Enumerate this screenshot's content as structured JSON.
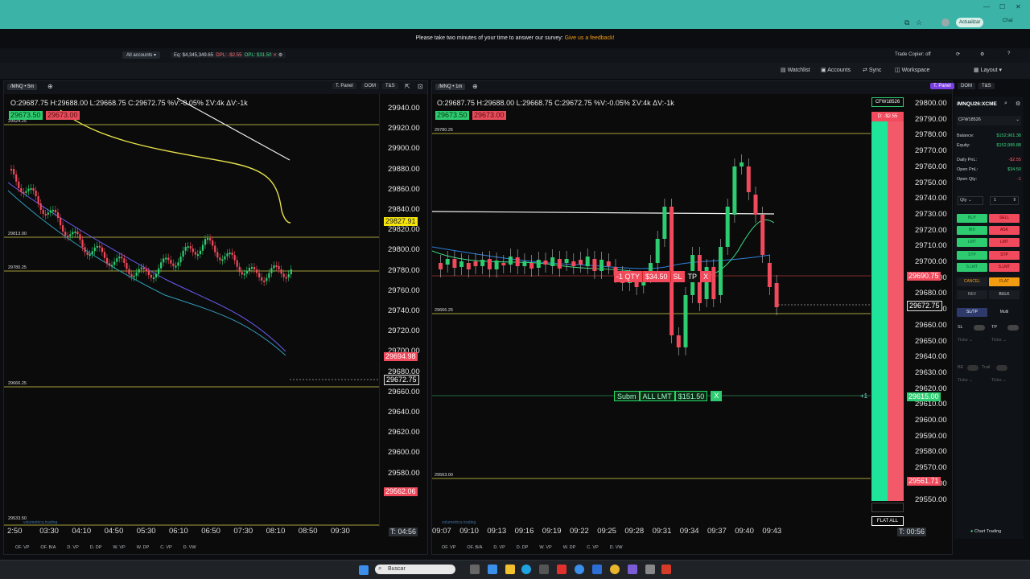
{
  "browser": {
    "update_label": "Actualizar",
    "chat_label": "Chat",
    "win_min": "—",
    "win_max": "☐",
    "win_close": "✕"
  },
  "survey": {
    "text": "Please take two minutes of your time to answer our survey:",
    "link": "Give us a feedback!"
  },
  "accounts": {
    "selector": "All accounts",
    "eq": "Eq: $4,345,349.65",
    "dpl": "DPL: -$2.55",
    "opl": "OPL: $31.50",
    "trade_copier": "Trade Copier: off"
  },
  "toolbar": {
    "watchlist": "Watchlist",
    "accounts": "Accounts",
    "sync": "Sync",
    "workspace": "Workspace",
    "layout": "Layout"
  },
  "left_chart": {
    "symbol": "/MNQ • 5m",
    "tpanel": "T. Panel",
    "dom": "DOM",
    "ts": "T&S",
    "ohlc": "O:29687.75  H:29688.00  L:29668.75  C:29672.75  %V:-0.05%  ΣV:4k  ΔV:-1k",
    "bid_tag": "29673.50",
    "ask_tag": "29673.00",
    "prices": [
      "29940.00",
      "29920.00",
      "29900.00",
      "29880.00",
      "29860.00",
      "29840.00",
      "29820.00",
      "29800.00",
      "29780.00",
      "29760.00",
      "29740.00",
      "29720.00",
      "29700.00",
      "29680.00",
      "29660.00",
      "29640.00",
      "29620.00",
      "29600.00",
      "29580.00"
    ],
    "level_labels": [
      "29924.25",
      "29813.00",
      "29780.25",
      "29666.25",
      "29533.50"
    ],
    "yellow_tag": "29827.91",
    "red_tag1": "29694.98",
    "white_tag": "29672.75",
    "red_tag2": "29562.06",
    "times": [
      "2:50",
      "03:30",
      "04:10",
      "04:50",
      "05:30",
      "06:10",
      "06:50",
      "07:30",
      "08:10",
      "08:50",
      "09:30"
    ],
    "timer": "T: 04:56",
    "footer": [
      "OF. VP",
      "OF. B/A",
      "D. VP",
      "D. DP",
      "W. VP",
      "W. DP",
      "C. VP",
      "D. VW"
    ]
  },
  "right_chart": {
    "symbol": "/MNQ • 1m",
    "tpanel": "T. Panel",
    "dom": "DOM",
    "ts": "T&S",
    "ohlc": "O:29687.75  H:29688.00  L:29668.75  C:29672.75  %V:-0.05%  ΣV:4k  ΔV:-1k",
    "bid_tag": "29673.50",
    "ask_tag": "29673.00",
    "prices": [
      "29800.00",
      "29790.00",
      "29780.00",
      "29770.00",
      "29760.00",
      "29750.00",
      "29740.00",
      "29730.00",
      "29720.00",
      "29710.00",
      "29700.00",
      "29690.00",
      "29680.00",
      "29670.00",
      "29660.00",
      "29650.00",
      "29640.00",
      "29630.00",
      "29620.00",
      "29610.00",
      "29600.00",
      "29590.00",
      "29580.00",
      "29570.00",
      "29560.00",
      "29550.00"
    ],
    "level_labels": [
      "29780.25",
      "29666.25",
      "29563.00"
    ],
    "red_tag1": "29690.75",
    "white_tag": "29672.75",
    "green_tag": "29615.00",
    "red_tag2": "29561.71",
    "order_qty": "-1 QTY",
    "order_pnl": "$34.50",
    "sl": "SL",
    "tp": "TP",
    "x": "X",
    "lmt_submit": "Subm",
    "lmt_all": "ALL LMT",
    "lmt_price": "$151.50",
    "lmt_x": "X",
    "lmt_plus": "+1",
    "times": [
      "09:07",
      "09:10",
      "09:13",
      "09:16",
      "09:19",
      "09:22",
      "09:25",
      "09:28",
      "09:31",
      "09:34",
      "09:37",
      "09:40",
      "09:43"
    ],
    "timer": "T: 00:56",
    "account_chip": "CFW18526",
    "pnl_chip": "D: -$2.55",
    "flat_all": "FLAT ALL",
    "footer": [
      "OF. VP",
      "OF. B/A",
      "D. VP",
      "D. DP",
      "W. VP",
      "W. DP",
      "C. VP",
      "D. VW"
    ]
  },
  "order_panel": {
    "tpanel_label": "T. Panel",
    "dom": "DOM",
    "ts": "T&S",
    "symbol": "/MNQU26:XCME",
    "account": "CFW18526",
    "balance_label": "Balance:",
    "balance": "$152,961.38",
    "equity_label": "Equity:",
    "equity": "$152,995.88",
    "dpnl_label": "Daily PnL:",
    "dpnl": "-$2.55",
    "opnl_label": "Open PnL:",
    "opnl": "$34.50",
    "oqty_label": "Open Qty:",
    "oqty": "-1",
    "qty_label": "Qty",
    "qty_value": "1",
    "buy": "BUY",
    "sell": "SELL",
    "bid": "BID",
    "ask": "ASK",
    "lmt": "LMT",
    "stp": "STP",
    "slmt": "S.LMT",
    "cancel": "CANCEL",
    "flat": "FLAT",
    "rev": "REV",
    "bulk": "BULK",
    "sltp": "SL/TP",
    "multi": "Multi",
    "sl": "SL",
    "tp": "TP",
    "ticks": "Ticks",
    "be": "BE",
    "trail": "Trail",
    "brand": "Chart Trading"
  },
  "taskbar": {
    "search": "Buscar"
  },
  "watermark": "volumetrica trading"
}
